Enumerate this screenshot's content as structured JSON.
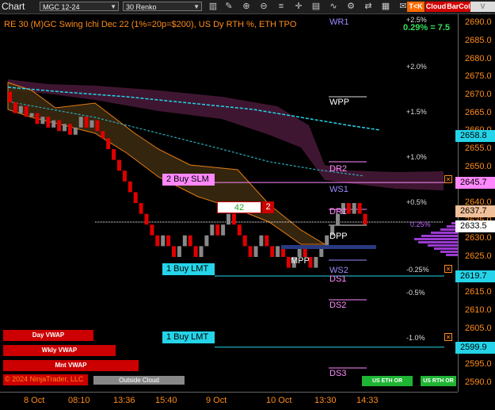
{
  "toolbar": {
    "title": "Chart",
    "instrument": "MGC 12-24",
    "bar_type": "30 Renko",
    "badge_tk": "T<K",
    "badge_cloud": "Cloud",
    "badge_barcol": "BarCol",
    "badge_vwap": "V WWA"
  },
  "header": {
    "description": "RE 30 (M)GC Swing Ichi Dec 22 (1%=20p=$200), US Dy RTH %, ETH TPO",
    "change": "0.29% = 7.5"
  },
  "price_axis": {
    "ticks": [
      "2690.0",
      "2685.0",
      "2680.0",
      "2675.0",
      "2670.0",
      "2665.0",
      "2660.0",
      "2655.0",
      "2650.0",
      "2645.0",
      "2640.0",
      "2635.0",
      "2630.0",
      "2625.0",
      "2620.0",
      "2615.0",
      "2610.0",
      "2605.0",
      "2600.0",
      "2595.0",
      "2590.0"
    ],
    "tags": [
      {
        "label": "2658.8",
        "price": 2658.8,
        "color": "#25d4e8"
      },
      {
        "label": "2645.7",
        "price": 2645.7,
        "color": "#ff88ff"
      },
      {
        "label": "2637.7",
        "price": 2637.7,
        "color": "#f0c09a"
      },
      {
        "label": "2633.5",
        "price": 2633.5,
        "color": "#ffffff"
      },
      {
        "label": "2619.7",
        "price": 2619.7,
        "color": "#25d4e8"
      },
      {
        "label": "2599.9",
        "price": 2599.9,
        "color": "#25d4e8"
      }
    ]
  },
  "time_axis": [
    "8 Oct",
    "08:10",
    "13:36",
    "15:40",
    "9 Oct",
    "10 Oct",
    "13:30",
    "14:33"
  ],
  "levels": {
    "WR1": "WR1",
    "WPP": "WPP",
    "DR2": "DR2",
    "WS1": "WS1",
    "DR1": "DR1",
    "DPP": "DPP",
    "MPP": "MPP",
    "WS2": "WS2",
    "DS1": "DS1",
    "DS2": "DS2",
    "DS3": "DS3"
  },
  "pct_labels": [
    "+2.5%",
    "+2.0%",
    "+1.5%",
    "+1.0%",
    "+0.5%",
    "0.25%",
    "-0.25%",
    "-0.5%",
    "-1.0%"
  ],
  "orders": [
    {
      "label": "2 Buy SLM",
      "price": 2645.7,
      "color": "#ff88ff"
    },
    {
      "label": "1 Buy LMT",
      "price": 2619.7,
      "color": "#25d4e8"
    },
    {
      "label": "1 Buy LMT",
      "price": 2599.9,
      "color": "#25d4e8"
    }
  ],
  "counter": {
    "value": "42",
    "qty": "2"
  },
  "buttons": {
    "day_vwap": "Day VWAP",
    "wkly_vwap": "Wkly VWAP",
    "mnt_vwap": "Mnt VWAP",
    "outside_cloud": "Outside Cloud",
    "us_eth": "US ETH OR",
    "us_rth": "US RTH OR"
  },
  "copyright": "© 2024 NinjaTrader, LLC",
  "colors": {
    "axis": "#ff8c1a",
    "up": "#888888",
    "down": "#e00000",
    "cyan": "#25d4e8",
    "magenta": "#ff88ff",
    "cloud": "#4a1a3a"
  },
  "chart_data": {
    "type": "line",
    "ylim": [
      2588,
      2693
    ],
    "renko_closes": [
      2668,
      2665,
      2667,
      2664,
      2665,
      2662,
      2664,
      2661,
      2663,
      2660,
      2662,
      2659,
      2661,
      2664,
      2661,
      2663,
      2660,
      2658,
      2655,
      2652,
      2649,
      2646,
      2643,
      2640,
      2637,
      2634,
      2631,
      2628,
      2631,
      2628,
      2625,
      2628,
      2631,
      2628,
      2625,
      2628,
      2631,
      2634,
      2631,
      2634,
      2637,
      2634,
      2631,
      2628,
      2625,
      2628,
      2631,
      2628,
      2625,
      2628,
      2625,
      2622,
      2625,
      2628,
      2625,
      2622,
      2625,
      2628,
      2631,
      2634,
      2637,
      2640,
      2637,
      2640,
      2637,
      2634
    ]
  }
}
